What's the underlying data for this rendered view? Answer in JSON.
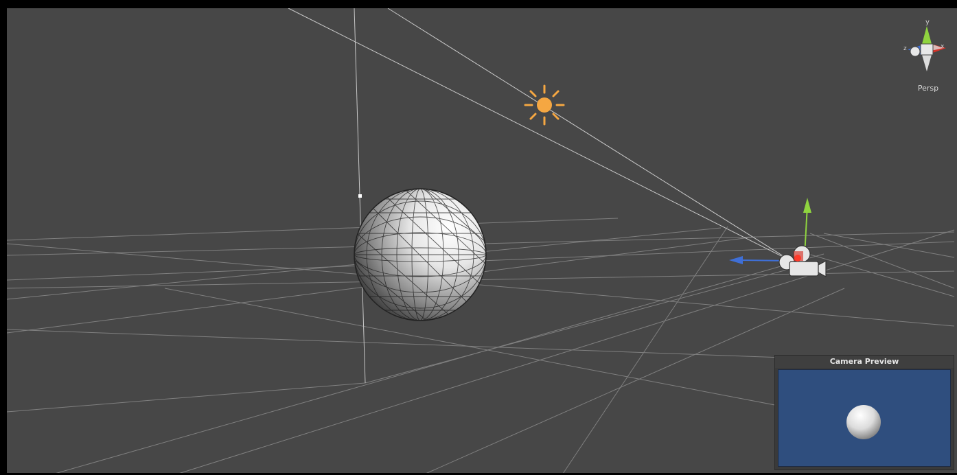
{
  "scene_view": {
    "projection_label": "Persp",
    "gizmo_axes": {
      "y": "y",
      "x": "x",
      "z": "z"
    }
  },
  "camera_preview": {
    "title": "Camera Preview"
  },
  "colors": {
    "background": "#474747",
    "grid": "#8e8e8e",
    "light_icon": "#f5a742",
    "axis_y": "#8fd43f",
    "axis_x": "#d6342a",
    "axis_z": "#3f6fd6",
    "preview_bg": "#2f4e7e"
  },
  "icons": {
    "directional_light": "sun-icon",
    "camera": "camera-icon",
    "orientation_gizmo": "axis-gizmo-icon"
  }
}
